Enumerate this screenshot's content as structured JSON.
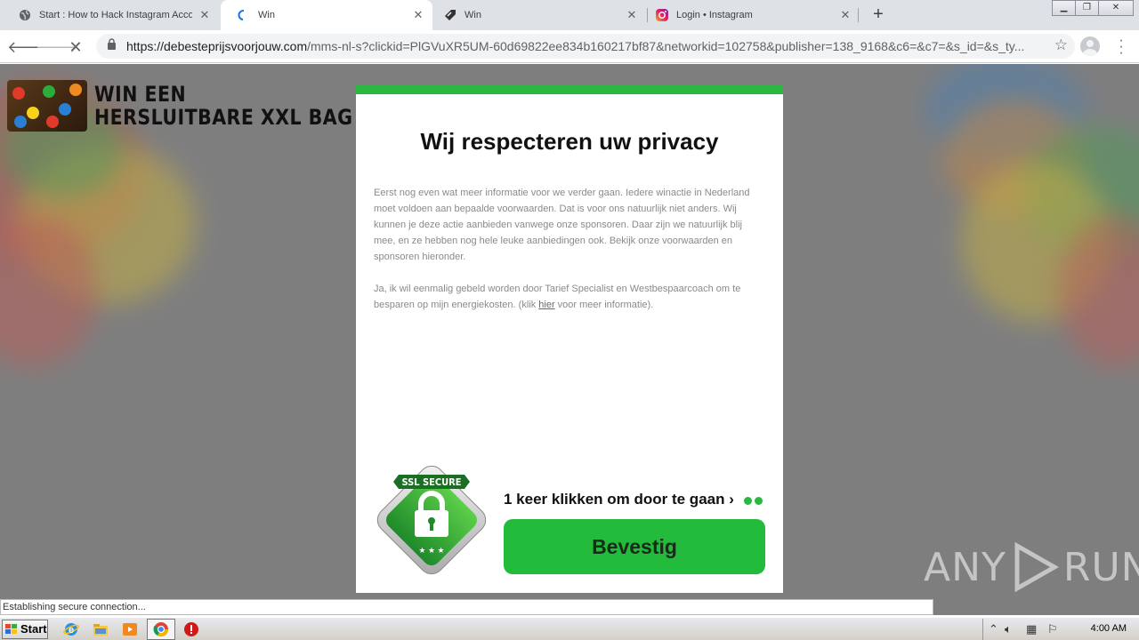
{
  "browser": {
    "tabs": [
      {
        "title": "Start : How to Hack Instagram Accou",
        "favicon": "globe-icon",
        "active": false
      },
      {
        "title": "Win",
        "favicon": "loading-icon",
        "active": true
      },
      {
        "title": "Win",
        "favicon": "tag-icon",
        "active": false
      },
      {
        "title": "Login • Instagram",
        "favicon": "instagram-icon",
        "active": false
      }
    ],
    "url_host": "https://debesteprijsvoorjouw.com",
    "url_rest": "/mms-nl-s?clickid=PlGVuXR5UM-60d69822ee834b160217bf87&networkid=102758&publisher=138_9168&c6=&c7=&s_id=&s_ty...",
    "status_text": "Establishing secure connection..."
  },
  "page": {
    "brand_line1": "WIN EEN",
    "brand_line2": "HERSLUITBARE XXL BAG",
    "modal": {
      "title": "Wij respecteren uw privacy",
      "paragraph1": "Eerst nog even wat meer informatie voor we verder gaan. Iedere winactie in Nederland moet voldoen aan bepaalde voorwaarden. Dat is voor ons natuurlijk niet anders. Wij kunnen je deze actie aanbieden vanwege onze sponsoren. Daar zijn we natuurlijk blij mee, en ze hebben nog hele leuke aanbiedingen ook. Bekijk onze voorwaarden en sponsoren hieronder.",
      "paragraph2_before": "Ja, ik wil eenmalig gebeld worden door Tarief Specialist en Westbespaarcoach om te besparen op mijn energiekosten. (klik ",
      "paragraph2_link": "hier",
      "paragraph2_after": " voor meer informatie).",
      "ssl_badge_text": "SSL SECURE",
      "cta_text": "1 keer klikken om door te gaan ›",
      "confirm_button": "Bevestig"
    },
    "watermark_left": "ANY",
    "watermark_right": "RUN"
  },
  "taskbar": {
    "start_label": "Start",
    "clock": "4:00 AM"
  },
  "colors": {
    "accent_green": "#2bb842",
    "button_green": "#23bb3c"
  }
}
